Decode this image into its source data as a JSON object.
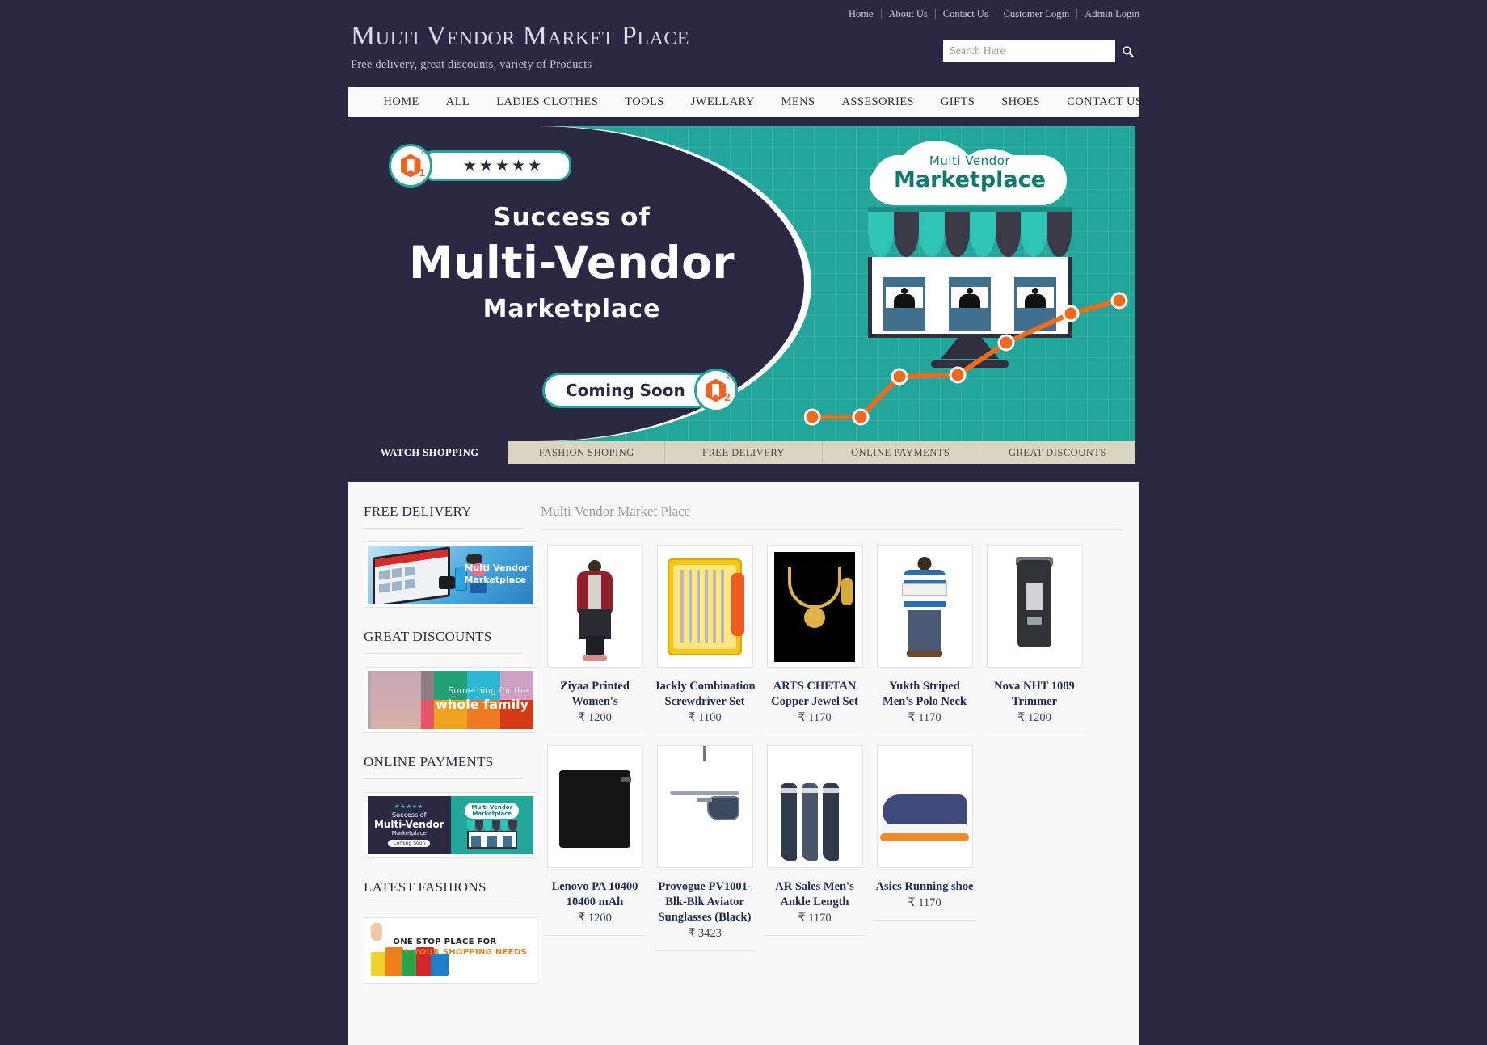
{
  "site": {
    "title": "Multi Vendor Market Place",
    "tagline": "Free delivery, great discounts, variety of Products"
  },
  "top_links": [
    {
      "label": "Home"
    },
    {
      "label": "About Us"
    },
    {
      "label": "Contact Us"
    },
    {
      "label": "Customer Login"
    },
    {
      "label": "Admin Login"
    }
  ],
  "search": {
    "placeholder": "Search Here",
    "value": "",
    "icon": "search-icon"
  },
  "nav": [
    {
      "label": "HOME"
    },
    {
      "label": "ALL"
    },
    {
      "label": "LADIES CLOTHES"
    },
    {
      "label": "TOOLS"
    },
    {
      "label": "JWELLARY"
    },
    {
      "label": "MENS"
    },
    {
      "label": "ASSESORIES"
    },
    {
      "label": "GIFTS"
    },
    {
      "label": "SHOES"
    },
    {
      "label": "CONTACT US"
    }
  ],
  "hero": {
    "badge_logo_number": "1",
    "stars": "★★★★★",
    "line1": "Success of",
    "line2": "Multi-Vendor",
    "line3": "Marketplace",
    "coming_soon": "Coming Soon",
    "coming_logo_number": "2",
    "shop_cloud_line1": "Multi Vendor",
    "shop_cloud_line2": "Marketplace"
  },
  "banner_tabs": [
    {
      "label": "WATCH SHOPPING",
      "active": true
    },
    {
      "label": "FASHION SHOPING",
      "active": false
    },
    {
      "label": "FREE DELIVERY",
      "active": false
    },
    {
      "label": "ONLINE PAYMENTS",
      "active": false
    },
    {
      "label": "GREAT DISCOUNTS",
      "active": false
    }
  ],
  "sidebar": {
    "sections": [
      {
        "heading": "FREE DELIVERY",
        "promo_text_1": "Multi Vendor",
        "promo_text_2": "Marketplace"
      },
      {
        "heading": "GREAT DISCOUNTS",
        "promo_text_1": "Something for the",
        "promo_text_2": "whole family"
      },
      {
        "heading": "ONLINE PAYMENTS",
        "promo_text_1": "Success of",
        "promo_text_2": "Multi-Vendor",
        "promo_text_3": "Marketplace",
        "promo_text_4": "Coming Soon"
      },
      {
        "heading": "LATEST FASHIONS",
        "promo_text_1": "ONE STOP PLACE FOR",
        "promo_text_2": "ALL YOUR SHOPPING NEEDS"
      }
    ]
  },
  "main": {
    "title": "Multi Vendor Market Place",
    "currency": "₹",
    "products": [
      {
        "name": "Ziyaa Printed Women's",
        "price": "₹ 1200",
        "image": "ladies-kurta-image"
      },
      {
        "name": "Jackly Combination Screwdriver Set",
        "price": "₹ 1100",
        "image": "screwdriver-set-image"
      },
      {
        "name": "ARTS CHETAN Copper Jewel Set",
        "price": "₹ 1170",
        "image": "jewellery-set-image"
      },
      {
        "name": "Yukth Striped Men's Polo Neck",
        "price": "₹ 1170",
        "image": "polo-shirt-image"
      },
      {
        "name": "Nova NHT 1089 Trimmer",
        "price": "₹ 1200",
        "image": "trimmer-image"
      },
      {
        "name": "Lenovo PA 10400 10400 mAh",
        "price": "₹ 1200",
        "image": "power-bank-image"
      },
      {
        "name": "Provogue PV1001-Blk-Blk Aviator Sunglasses (Black)",
        "price": "₹ 3423",
        "image": "sunglasses-image"
      },
      {
        "name": "AR Sales Men's Ankle Length",
        "price": "₹ 1170",
        "image": "socks-image"
      },
      {
        "name": "Asics Running shoe",
        "price": "₹ 1170",
        "image": "running-shoe-image"
      }
    ]
  },
  "colors": {
    "page_bg": "#2b2844",
    "accent_teal": "#22a699",
    "accent_orange": "#f26322",
    "content_bg": "#f8f8f8",
    "product_title": "#1f2a52"
  }
}
